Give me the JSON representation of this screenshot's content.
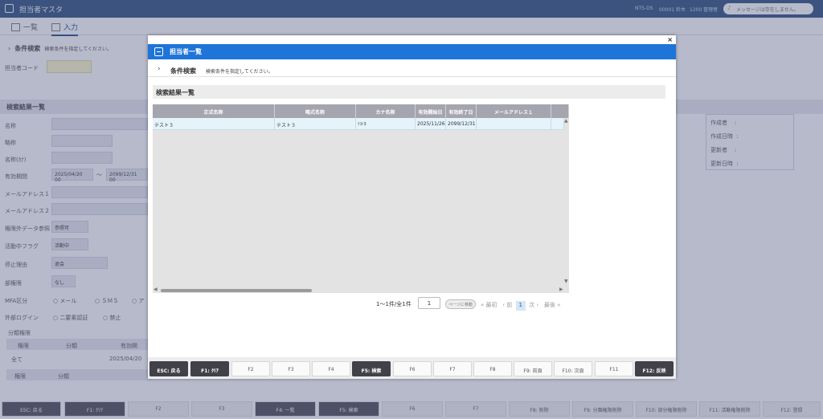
{
  "app": {
    "title": "担当者マスタ",
    "user_info": [
      "NTS-DS",
      "00001 鈴木",
      "1200 管理者"
    ],
    "message": "メッセージは存在しません。"
  },
  "main_tabs": [
    {
      "label": "一覧",
      "active": false
    },
    {
      "label": "入力",
      "active": true
    }
  ],
  "background": {
    "cond_label": "条件検索",
    "cond_hint": "検索条件を指定してください。",
    "code_label": "担当者コード",
    "result_title": "検索結果一覧",
    "fields": [
      "名称",
      "略称",
      "名称(ｶﾅ)",
      "有効期間",
      "メールアドレス１",
      "メールアドレス２",
      "権限外データ参照",
      "活動中フラグ",
      "停止理由",
      "部権限",
      "MFA区分",
      "外部ログイン",
      "分類権限"
    ],
    "date_from": "2025/04/20 00",
    "date_sep": "〜",
    "date_to": "2099/12/31 00",
    "select1": "参照可",
    "select2": "活動中",
    "select3": "退会",
    "select4": "なし",
    "mfa_options": [
      "メール",
      "ＳＭＳ",
      "ア"
    ],
    "login_options": [
      "二要素認証",
      "禁止"
    ],
    "bunrui_headers": [
      "権限",
      "分類",
      "有効開"
    ],
    "bunrui_row": [
      "全て",
      "",
      "2025/04/20"
    ],
    "bunrui_headers2": [
      "権限",
      "分類"
    ],
    "meta_labels": [
      "作成者",
      "作成日時",
      "更新者",
      "更新日時"
    ],
    "meta_colon": ":",
    "fkeys": [
      "ESC: 戻る",
      "F1: ｸﾘｱ",
      "F2",
      "F3",
      "F4: 一覧",
      "F5: 検索",
      "F6",
      "F7",
      "F8: 削除",
      "F9: 分類権限削除",
      "F10: 部分権限削除",
      "F11: 活動権限削除",
      "F12: 登録"
    ]
  },
  "modal": {
    "title": "担当者一覧",
    "close": "×",
    "cond_label": "条件検索",
    "cond_hint": "検索条件を指定してください。",
    "result_title": "検索結果一覧",
    "columns": [
      "正式名称",
      "略式名称",
      "カナ名称",
      "有効開始日",
      "有効終了日",
      "メールアドレス１",
      ""
    ],
    "rows": [
      [
        "テスト３",
        "テスト３",
        "ﾃｽﾄ3",
        "2025/11/26",
        "2099/12/31",
        "",
        ""
      ]
    ],
    "pager": {
      "summary": "1〜1件/全1件",
      "page_input": "1",
      "go_label": "ページに移動",
      "first": "最初",
      "prev": "前",
      "current": "1",
      "next": "次",
      "last": "最後"
    },
    "fkeys": [
      "ESC: 戻る",
      "F1: ｸﾘｱ",
      "F2",
      "F3",
      "F4",
      "F5: 検索",
      "F6",
      "F7",
      "F8",
      "F9: 前頁",
      "F10: 次頁",
      "F11",
      "F12: 反映"
    ]
  }
}
